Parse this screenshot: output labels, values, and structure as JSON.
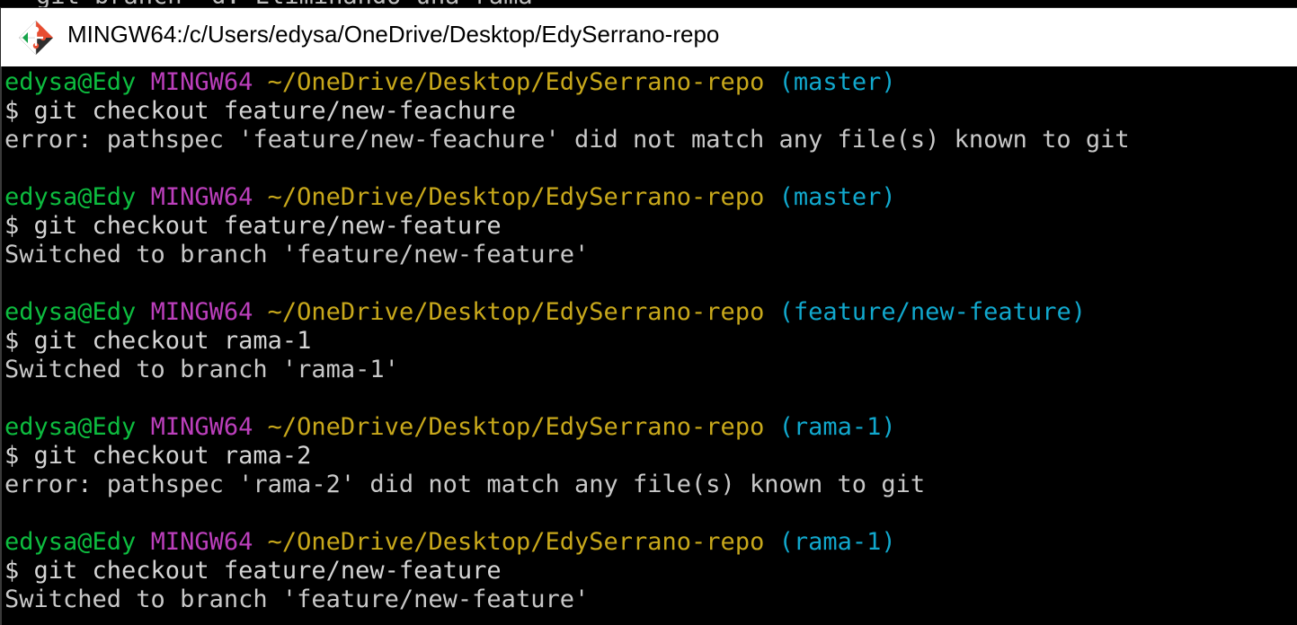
{
  "window": {
    "title": "MINGW64:/c/Users/edysa/OneDrive/Desktop/EdySerrano-repo",
    "top_strip_text": "git branch -d: Eliminando una rama"
  },
  "colors": {
    "user": "#0dbc3f",
    "system": "#bc3fbc",
    "path": "#c8a81b",
    "branch": "#11a8cd",
    "text": "#c8c8c8",
    "background": "#000000"
  },
  "blocks": [
    {
      "user": "edysa@Edy",
      "system": "MINGW64",
      "path": "~/OneDrive/Desktop/EdySerrano-repo",
      "branch": "(master)",
      "command": "$ git checkout feature/new-feachure",
      "output": "error: pathspec 'feature/new-feachure' did not match any file(s) known to git"
    },
    {
      "user": "edysa@Edy",
      "system": "MINGW64",
      "path": "~/OneDrive/Desktop/EdySerrano-repo",
      "branch": "(master)",
      "command": "$ git checkout feature/new-feature",
      "output": "Switched to branch 'feature/new-feature'"
    },
    {
      "user": "edysa@Edy",
      "system": "MINGW64",
      "path": "~/OneDrive/Desktop/EdySerrano-repo",
      "branch": "(feature/new-feature)",
      "command": "$ git checkout rama-1",
      "output": "Switched to branch 'rama-1'"
    },
    {
      "user": "edysa@Edy",
      "system": "MINGW64",
      "path": "~/OneDrive/Desktop/EdySerrano-repo",
      "branch": "(rama-1)",
      "command": "$ git checkout rama-2",
      "output": "error: pathspec 'rama-2' did not match any file(s) known to git"
    },
    {
      "user": "edysa@Edy",
      "system": "MINGW64",
      "path": "~/OneDrive/Desktop/EdySerrano-repo",
      "branch": "(rama-1)",
      "command": "$ git checkout feature/new-feature",
      "output": "Switched to branch 'feature/new-feature'"
    }
  ]
}
